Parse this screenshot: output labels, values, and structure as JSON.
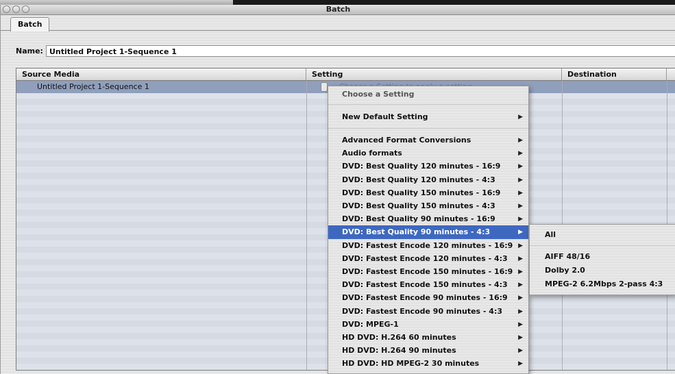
{
  "window": {
    "title": "Batch"
  },
  "tab": {
    "label": "Batch"
  },
  "name_field": {
    "label": "Name:",
    "value": "Untitled Project 1-Sequence 1"
  },
  "table": {
    "columns": [
      "Source Media",
      "Setting",
      "Destination"
    ],
    "row": {
      "source": "Untitled Project 1-Sequence 1",
      "setting_placeholder": "Choose a Setting to apply a setting"
    }
  },
  "menu": {
    "header": "Choose a Setting",
    "new_default": "New Default Setting",
    "items": [
      "Advanced Format Conversions",
      "Audio formats",
      "DVD: Best Quality 120 minutes - 16:9",
      "DVD: Best Quality 120 minutes - 4:3",
      "DVD: Best Quality 150 minutes - 16:9",
      "DVD: Best Quality 150 minutes - 4:3",
      "DVD: Best Quality 90 minutes - 16:9",
      "DVD: Best Quality 90 minutes - 4:3",
      "DVD: Fastest Encode 120 minutes - 16:9",
      "DVD: Fastest Encode 120 minutes - 4:3",
      "DVD: Fastest Encode 150 minutes - 16:9",
      "DVD: Fastest Encode 150 minutes - 4:3",
      "DVD: Fastest Encode 90 minutes - 16:9",
      "DVD: Fastest Encode 90 minutes - 4:3",
      "DVD: MPEG-1",
      "HD DVD: H.264 60 minutes",
      "HD DVD: H.264 90 minutes",
      "HD DVD: HD MPEG-2 30 minutes"
    ],
    "selected_index": 7,
    "arrow_icon": "submenu-arrow-icon"
  },
  "submenu": {
    "all": "All",
    "items": [
      "AIFF 48/16",
      "Dolby 2.0",
      "MPEG-2 6.2Mbps 2-pass 4:3"
    ]
  }
}
